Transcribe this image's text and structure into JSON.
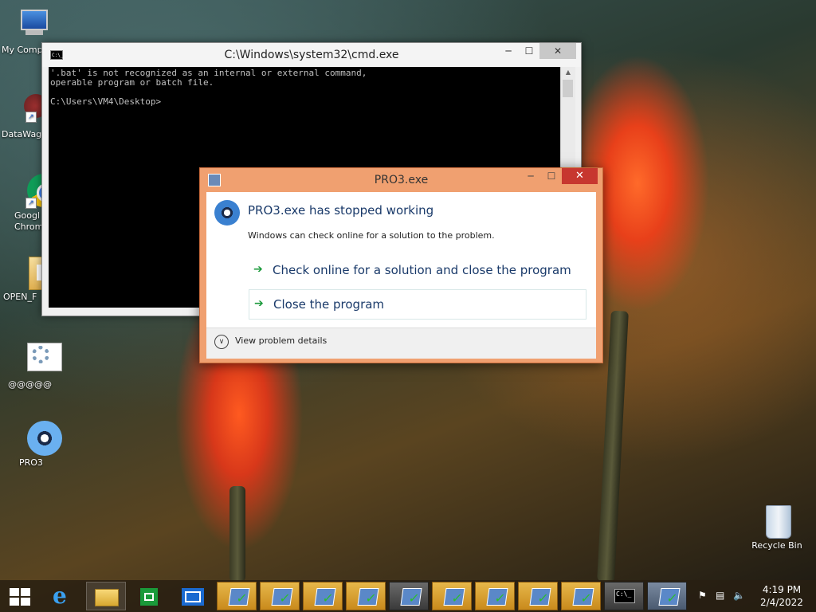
{
  "desktop": {
    "icons": [
      {
        "label": "My Comp",
        "icon": "computer-icon"
      },
      {
        "label": "DataWag",
        "icon": "datawag-icon"
      },
      {
        "label": "Googl\nChrom",
        "icon": "chrome-icon"
      },
      {
        "label": "OPEN_F",
        "icon": "folder-icon"
      },
      {
        "label": "@@@@@",
        "icon": "settings-icon"
      },
      {
        "label": "PRO3",
        "icon": "disc-icon"
      },
      {
        "label": "Recycle Bin",
        "icon": "recycle-bin-icon"
      }
    ]
  },
  "cmd_window": {
    "title": "C:\\Windows\\system32\\cmd.exe",
    "icon_text": "C:\\_",
    "lines": [
      "'.bat' is not recognized as an internal or external command,",
      "operable program or batch file.",
      "",
      "C:\\Users\\VM4\\Desktop>"
    ],
    "minimize": "─",
    "maximize": "☐",
    "close": "✕"
  },
  "dialog": {
    "title": "PRO3.exe",
    "heading": "PRO3.exe has stopped working",
    "message": "Windows can check online for a solution to the problem.",
    "options": [
      "Check online for a solution and close the program",
      "Close the program"
    ],
    "details": "View problem details",
    "minimize": "─",
    "maximize": "☐",
    "close": "✕"
  },
  "taskbar": {
    "start_icon": "windows-start-icon",
    "pinned": [
      "internet-explorer-icon",
      "file-explorer-icon",
      "store-icon",
      "mail-icon"
    ],
    "running_count": 11,
    "clock_time": "4:19 PM",
    "clock_date": "2/4/2022",
    "colors": {
      "accent": "#f0a070",
      "close": "#c7372f",
      "arrow": "#1c9a3c",
      "heading": "#1a3a6a"
    }
  }
}
